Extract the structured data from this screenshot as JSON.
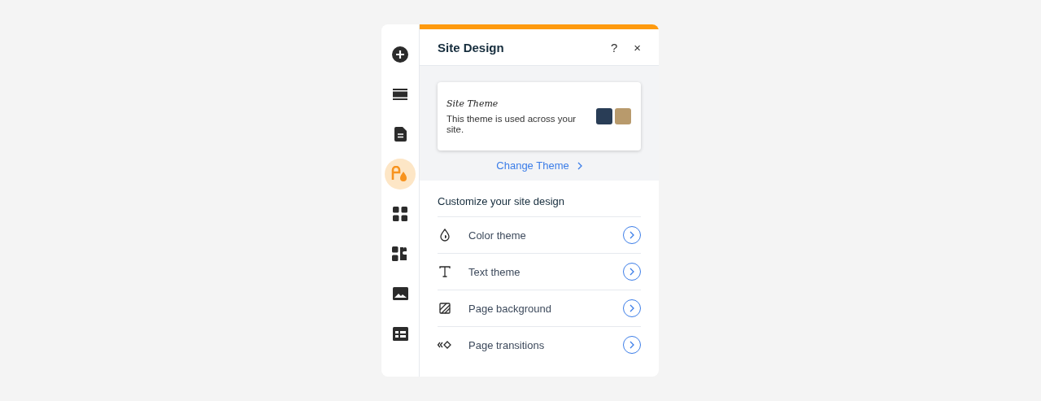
{
  "sidebar": {
    "items": [
      {
        "kind": "add",
        "selected": false
      },
      {
        "kind": "sections",
        "selected": false
      },
      {
        "kind": "pages",
        "selected": false
      },
      {
        "kind": "design",
        "selected": true
      },
      {
        "kind": "apps",
        "selected": false
      },
      {
        "kind": "business",
        "selected": false
      },
      {
        "kind": "media",
        "selected": false
      },
      {
        "kind": "cms",
        "selected": false
      }
    ]
  },
  "panel": {
    "title": "Site Design",
    "help": "?",
    "close": "×",
    "theme_card": {
      "title": "Site Theme",
      "text": "This theme is used across your site.",
      "swatches": [
        {
          "color": "#293d56"
        },
        {
          "color": "#b89a6c"
        }
      ]
    },
    "change_theme": "Change Theme",
    "section_title": "Customize your site design",
    "rows": [
      {
        "kind": "color",
        "label": "Color theme"
      },
      {
        "kind": "text",
        "label": "Text theme"
      },
      {
        "kind": "background",
        "label": "Page background"
      },
      {
        "kind": "transitions",
        "label": "Page transitions"
      }
    ]
  }
}
